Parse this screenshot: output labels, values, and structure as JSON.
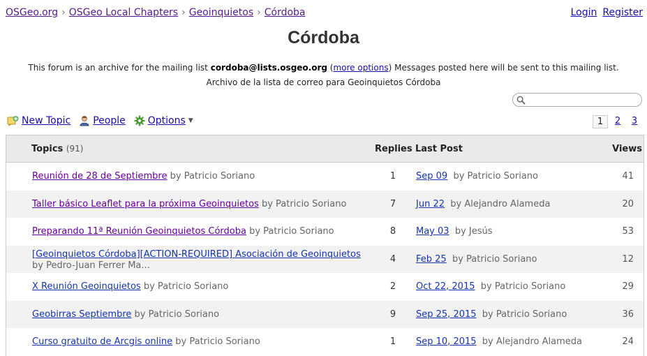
{
  "breadcrumb": {
    "items": [
      "OSGeo.org",
      "OSGeo Local Chapters",
      "Geoinquietos",
      "Córdoba"
    ],
    "separator": "›"
  },
  "auth": {
    "login": "Login",
    "register": "Register"
  },
  "page": {
    "title": "Córdoba",
    "desc_prefix": "This forum is an archive for the mailing list",
    "desc_email": "cordoba@lists.osgeo.org",
    "desc_more_options": "more options",
    "desc_suffix": "Messages posted here will be sent to this mailing list.",
    "subtitle": "Archivo de la lista de correo para Geoinquietos Córdoba"
  },
  "search": {
    "placeholder": "",
    "icon": "search-icon"
  },
  "toolbar": {
    "new_topic": "New Topic",
    "people": "People",
    "options": "Options"
  },
  "pager": {
    "current": "1",
    "pages": [
      "2",
      "3"
    ]
  },
  "table": {
    "headers": {
      "topics": "Topics",
      "topics_count": "(91)",
      "replies": "Replies",
      "last_post": "Last Post",
      "views": "Views"
    },
    "rows": [
      {
        "title": "Reunión de 28 de Septiembre",
        "author": "by Patricio Soriano",
        "replies": "1",
        "last_date": "Sep 09",
        "last_author": "by Patricio Soriano",
        "views": "41"
      },
      {
        "title": "Taller básico Leaflet para la próxima Geoinquietos",
        "author": "by Patricio Soriano",
        "replies": "7",
        "last_date": "Jun 22",
        "last_author": "by Alejandro Alameda",
        "views": "20"
      },
      {
        "title": "Preparando 11ª Reunión Geoinquietos Córdoba",
        "author": "by Patricio Soriano",
        "replies": "8",
        "last_date": "May 03",
        "last_author": "by Jesús",
        "views": "53"
      },
      {
        "title": "[Geoinquietos Córdoba][ACTION-REQUIRED] Asociación de Geoinquietos",
        "author": "by Pedro-Juan Ferrer Ma...",
        "replies": "4",
        "last_date": "Feb 25",
        "last_author": "by Patricio Soriano",
        "views": "12"
      },
      {
        "title": "X Reunión Geoinquietos",
        "author": "by Patricio Soriano",
        "replies": "2",
        "last_date": "Oct 22, 2015",
        "last_author": "by Patricio Soriano",
        "views": "29"
      },
      {
        "title": "Geobirras Septiembre",
        "author": "by Patricio Soriano",
        "replies": "9",
        "last_date": "Sep 25, 2015",
        "last_author": "by Patricio Soriano",
        "views": "36"
      },
      {
        "title": "Curso gratuito de Arcgis online",
        "author": "by Patricio Soriano",
        "replies": "1",
        "last_date": "Sep 10, 2015",
        "last_author": "by Alejandro Alameda",
        "views": "24"
      }
    ]
  }
}
